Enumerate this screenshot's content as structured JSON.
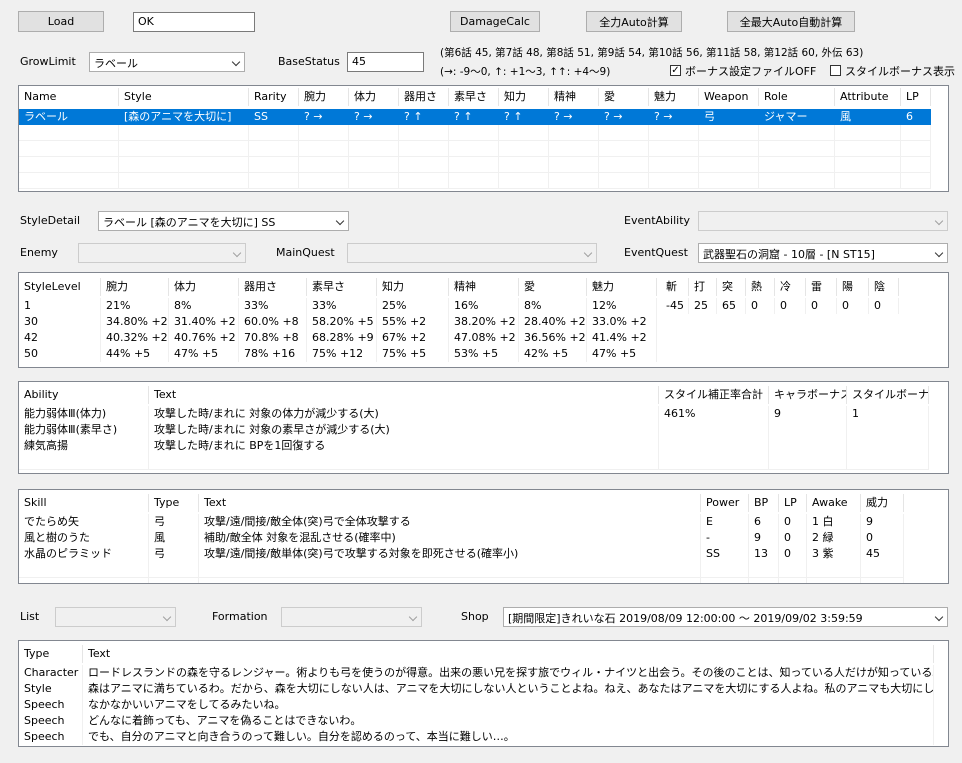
{
  "toolbar": {
    "load": "Load",
    "status_value": "OK",
    "damage_calc": "DamageCalc",
    "full_auto": "全力Auto計算",
    "max_auto": "全最大Auto自動計算"
  },
  "settings": {
    "grow_limit_label": "GrowLimit",
    "grow_limit_value": "ラベール",
    "base_status_label": "BaseStatus",
    "base_status_value": "45",
    "episodes_info": "(第6話 45, 第7話 48, 第8話 51, 第9話 54, 第10話 56, 第11話 58, 第12話 60, 外伝 63)",
    "arrow_info": "(→: -9～0, ↑: +1～3, ↑↑: +4～9)",
    "bonus_off_label": "ボーナス設定ファイルOFF",
    "bonus_off_checked": true,
    "style_bonus_label": "スタイルボーナス表示",
    "style_bonus_checked": false
  },
  "char_table": {
    "headers": [
      "Name",
      "Style",
      "Rarity",
      "腕力",
      "体力",
      "器用さ",
      "素早さ",
      "知力",
      "精神",
      "愛",
      "魅力",
      "Weapon",
      "Role",
      "Attribute",
      "LP"
    ],
    "rows": [
      [
        "ラベール",
        "[森のアニマを大切に]",
        "SS",
        "? →",
        "? →",
        "? ↑",
        "? ↑",
        "? ↑",
        "? →",
        "? →",
        "? →",
        "弓",
        "ジャマー",
        "風",
        "6"
      ]
    ]
  },
  "filters": {
    "style_detail_label": "StyleDetail",
    "style_detail_value": "ラベール [森のアニマを大切に] SS",
    "event_ability_label": "EventAbility",
    "event_ability_value": "",
    "enemy_label": "Enemy",
    "enemy_value": "",
    "main_quest_label": "MainQuest",
    "main_quest_value": "",
    "event_quest_label": "EventQuest",
    "event_quest_value": "武器聖石の洞窟 - 10層 - [N ST15]"
  },
  "level_table": {
    "headers": [
      "StyleLevel",
      "腕力",
      "体力",
      "器用さ",
      "素早さ",
      "知力",
      "精神",
      "愛",
      "魅力"
    ],
    "rows": [
      [
        "1",
        "21%",
        "8%",
        "33%",
        "33%",
        "25%",
        "16%",
        "8%",
        "12%"
      ],
      [
        "30",
        "34.80% +2",
        "31.40% +2",
        "60.0% +8",
        "58.20% +5",
        "55% +2",
        "38.20% +2",
        "28.40% +2",
        "33.0% +2"
      ],
      [
        "42",
        "40.32% +2",
        "40.76% +2",
        "70.8% +8",
        "68.28% +9",
        "67% +2",
        "47.08% +2",
        "36.56% +2",
        "41.4% +2"
      ],
      [
        "50",
        "44% +5",
        "47% +5",
        "78% +16",
        "75% +12",
        "75% +5",
        "53% +5",
        "42% +5",
        "47% +5"
      ]
    ]
  },
  "resist_table": {
    "headers": [
      "斬",
      "打",
      "突",
      "熱",
      "冷",
      "雷",
      "陽",
      "陰"
    ],
    "values": [
      "-45",
      "25",
      "65",
      "0",
      "0",
      "0",
      "0",
      "0"
    ]
  },
  "ability_table": {
    "headers": [
      "Ability",
      "Text",
      "スタイル補正率合計",
      "キャラボーナス",
      "スタイルボーナス"
    ],
    "rows": [
      [
        "能力弱体Ⅲ(体力)",
        "攻撃した時/まれに 対象の体力が減少する(大)",
        "461%",
        "9",
        "1"
      ],
      [
        "能力弱体Ⅲ(素早さ)",
        "攻撃した時/まれに 対象の素早さが減少する(大)",
        "",
        "",
        ""
      ],
      [
        "練気高揚",
        "攻撃した時/まれに BPを1回復する",
        "",
        "",
        ""
      ]
    ]
  },
  "skill_table": {
    "headers": [
      "Skill",
      "Type",
      "Text",
      "Power",
      "BP",
      "LP",
      "Awake",
      "威力"
    ],
    "rows": [
      [
        "でたらめ矢",
        "弓",
        "攻撃/遠/間接/敵全体(突)弓で全体攻撃する",
        "E",
        "6",
        "0",
        "1 白",
        "9"
      ],
      [
        "風と樹のうた",
        "風",
        "補助/敵全体 対象を混乱させる(確率中)",
        "-",
        "9",
        "0",
        "2 緑",
        "0"
      ],
      [
        "水晶のピラミッド",
        "弓",
        "攻撃/遠/間接/敵単体(突)弓で攻撃する対象を即死させる(確率小)",
        "SS",
        "13",
        "0",
        "3 紫",
        "45"
      ]
    ]
  },
  "bottom_filters": {
    "list_label": "List",
    "list_value": "",
    "formation_label": "Formation",
    "formation_value": "",
    "shop_label": "Shop",
    "shop_value": "[期間限定]きれいな石 2019/08/09 12:00:00 ～ 2019/09/02 3:59:59"
  },
  "text_table": {
    "headers": [
      "Type",
      "Text"
    ],
    "rows": [
      [
        "Character",
        "ロードレスランドの森を守るレンジャー。術よりも弓を使うのが得意。出来の悪い兄を探す旅でウィル・ナイツと出会う。その後のことは、知っている人だけが知っている。"
      ],
      [
        "Style",
        "森はアニマに満ちているわ。だから、森を大切にしない人は、アニマを大切にしない人ということよね。ねえ、あなたはアニマを大切にする人よね。私のアニマも大切にしてくれるのかな…。"
      ],
      [
        "Speech",
        "なかなかいいアニマをしてるみたいね。"
      ],
      [
        "Speech",
        "どんなに着飾っても、アニマを偽ることはできないわ。"
      ],
      [
        "Speech",
        "でも、自分のアニマと向き合うのって難しい。自分を認めるのって、本当に難しい…。"
      ]
    ]
  }
}
